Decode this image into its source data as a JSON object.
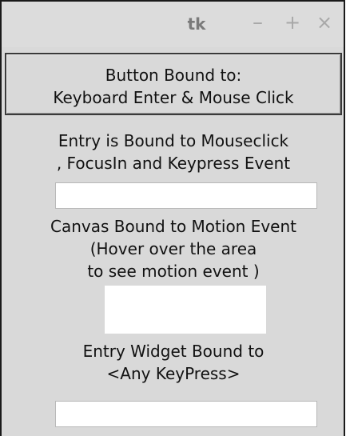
{
  "window": {
    "title": "tk",
    "controls": {
      "minimize": "–",
      "maximize": "+",
      "close": "×"
    }
  },
  "button": {
    "line1": "Button Bound to:",
    "line2": "Keyboard Enter & Mouse Click"
  },
  "entry1_label": {
    "line1": "Entry is Bound to Mouseclick",
    "line2": ", FocusIn and Keypress Event"
  },
  "entry1": {
    "value": ""
  },
  "canvas_label": {
    "line1": "Canvas Bound to Motion Event",
    "line2": "(Hover over the area",
    "line3": "to see motion event )"
  },
  "entry2_label": {
    "line1": "Entry Widget Bound to",
    "line2": "<Any KeyPress>"
  },
  "entry2": {
    "value": ""
  },
  "colors": {
    "window_bg": "#d9d9d9",
    "titlebar_text": "#7a7a7a",
    "field_bg": "#ffffff"
  }
}
